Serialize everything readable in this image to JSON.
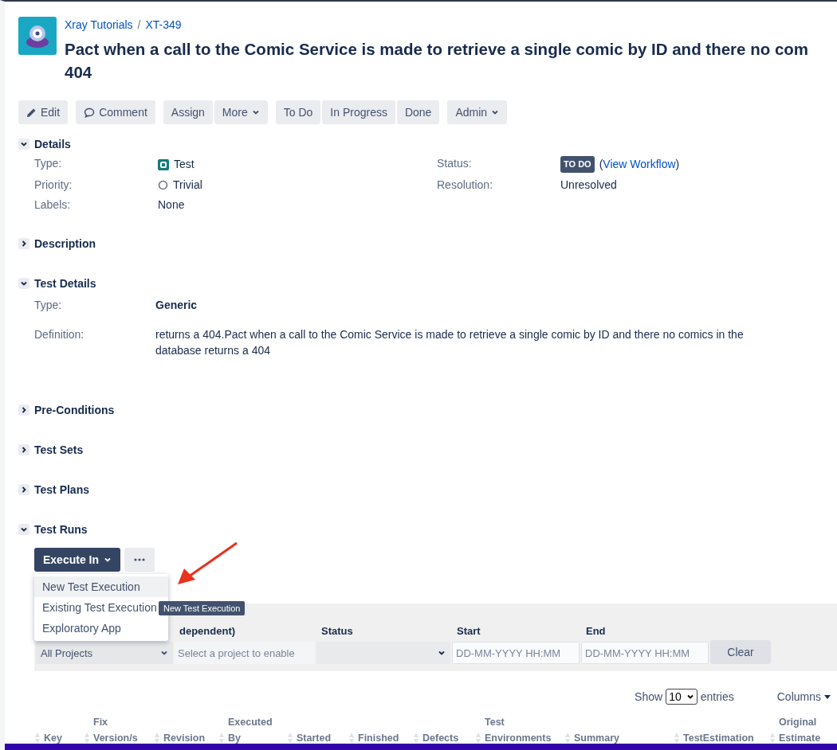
{
  "breadcrumbs": {
    "separator": "/",
    "items": [
      {
        "label": "Xray Tutorials"
      },
      {
        "label": "XT-349"
      }
    ]
  },
  "title_lines": [
    "Pact when a call to the Comic Service is made to retrieve a single comic by ID and there no com",
    "404"
  ],
  "toolbar": [
    [
      {
        "label": "Edit",
        "kind": "edit"
      }
    ],
    [
      {
        "label": "Comment",
        "kind": "comment"
      }
    ],
    [
      {
        "label": "Assign",
        "kind": "plain"
      },
      {
        "label": "More",
        "kind": "dropdown"
      }
    ],
    [
      {
        "label": "To Do",
        "kind": "plain"
      },
      {
        "label": "In Progress",
        "kind": "plain"
      },
      {
        "label": "Done",
        "kind": "plain"
      }
    ],
    [
      {
        "label": "Admin",
        "kind": "dropdown"
      }
    ]
  ],
  "sections": [
    {
      "kind": "details",
      "title": "Details",
      "expanded": true,
      "left": [
        {
          "label": "Type:",
          "value": "Test",
          "kind": "test"
        },
        {
          "label": "Priority:",
          "value": "Trivial",
          "kind": "priority"
        },
        {
          "label": "Labels:",
          "value": "None",
          "kind": "plain"
        }
      ],
      "status": {
        "label": "Status:",
        "badge": "TO DO",
        "open": "(",
        "link": "View Workflow",
        "close": ")"
      },
      "resolution": {
        "label": "Resolution:",
        "value": "Unresolved"
      }
    },
    {
      "title": "Description",
      "expanded": false
    },
    {
      "kind": "test_details",
      "title": "Test Details",
      "expanded": true,
      "type_label": "Type:",
      "type_value": "Generic",
      "definition_label": "Definition:",
      "definition": "returns a 404.Pact when a call to the Comic Service is made to retrieve a single comic by ID and there no comics in the database returns a 404"
    },
    {
      "title": "Pre-Conditions",
      "expanded": false
    },
    {
      "title": "Test Sets",
      "expanded": false
    },
    {
      "title": "Test Plans",
      "expanded": false
    },
    {
      "kind": "test_runs",
      "title": "Test Runs",
      "expanded": true
    }
  ],
  "test_runs": {
    "execute_button": "Execute In",
    "menu": [
      {
        "label": "New Test Execution",
        "selected": true
      },
      {
        "label": "Existing Test Execution",
        "selected": false
      },
      {
        "label": "Exploratory App",
        "selected": false
      }
    ],
    "tooltip": "New Test Execution",
    "filters": {
      "project_value": "All Projects",
      "version_label": "dependent)",
      "version_placeholder": "Select a project to enable",
      "status_label": "Status",
      "start_label": "Start",
      "start_placeholder": "DD-MM-YYYY HH:MM",
      "end_label": "End",
      "end_placeholder": "DD-MM-YYYY HH:MM",
      "clear": "Clear"
    },
    "show": "Show",
    "page_size": "10",
    "entries": "entries",
    "columns_button": "Columns",
    "columns": [
      "Key",
      "Fix Version/s",
      "Revision",
      "Executed By",
      "Started",
      "Finished",
      "Defects",
      "Test Environments",
      "Summary",
      "TestEstimation",
      "Original Estimate"
    ]
  }
}
